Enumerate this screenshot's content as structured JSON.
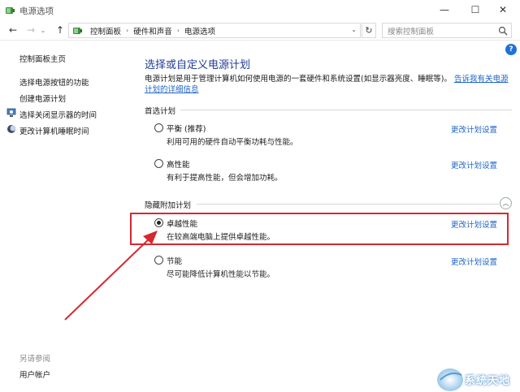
{
  "window": {
    "title": "电源选项"
  },
  "titlebar_buttons": {
    "minimize": "—",
    "maximize": "☐",
    "close": "✕"
  },
  "nav": {
    "back": "←",
    "forward": "→",
    "recent": "⌄",
    "up": "↑",
    "refresh": "↻",
    "dropdown": "⌄"
  },
  "breadcrumb": [
    "控制面板",
    "硬件和声音",
    "电源选项"
  ],
  "breadcrumb_sep": "›",
  "search": {
    "placeholder": "搜索控制面板"
  },
  "help": "?",
  "sidebar": {
    "home": "控制面板主页",
    "items": [
      {
        "label": "选择电源按钮的功能"
      },
      {
        "label": "创建电源计划"
      },
      {
        "label": "选择关闭显示器的时间",
        "icon": "monitor-icon"
      },
      {
        "label": "更改计算机睡眠时间",
        "icon": "moon-icon"
      }
    ],
    "see_also": "另请参阅",
    "user_accounts": "用户帐户"
  },
  "main": {
    "title": "选择或自定义电源计划",
    "description": "电源计划是用于管理计算机如何使用电源的一套硬件和系统设置(如显示器亮度、睡眠等)。",
    "description_link": "告诉我有关电源计划的详细信息",
    "preferred_header": "首选计划",
    "hidden_header": "隐藏附加计划",
    "change_label": "更改计划设置",
    "plans": [
      {
        "name": "平衡 (推荐)",
        "desc": "利用可用的硬件自动平衡功耗与性能。",
        "selected": false
      },
      {
        "name": "高性能",
        "desc": "有利于提高性能，但会增加功耗。",
        "selected": false
      },
      {
        "name": "卓越性能",
        "desc": "在较高端电脑上提供卓越性能。",
        "selected": true
      },
      {
        "name": "节能",
        "desc": "尽可能降低计算机性能以节能。",
        "selected": false
      }
    ]
  },
  "watermark": "系统天地",
  "colors": {
    "title_blue": "#1e3c96",
    "link_blue": "#1e64c8",
    "highlight_red": "#d62830",
    "help_blue": "#1e73d8"
  }
}
